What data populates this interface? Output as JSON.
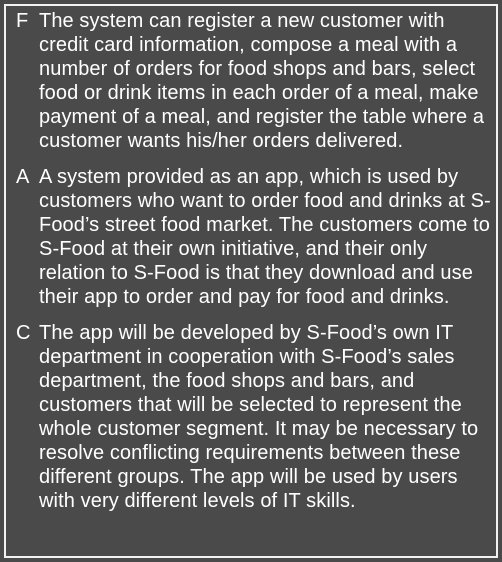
{
  "items": [
    {
      "letter": "F",
      "text": "The system can register a new customer with credit card information, compose a meal with a number of orders for food shops and bars, select food or drink items in each order of a meal, make payment of a meal, and register the table where a customer wants his/her orders delivered."
    },
    {
      "letter": "A",
      "text": "A system provided as an app, which is used by customers who want to order food and drinks at S-Food’s street food market. The customers come to S-Food at their own initiative, and their only relation to S-Food is that they download and use their app to order and pay for food and drinks."
    },
    {
      "letter": "C",
      "text": "The app will be developed by S-Food’s own IT department in cooperation with S-Food’s sales department, the food shops and bars, and customers that will be selected to represent the whole customer segment. It may be necessary to resolve conflicting requirements between these different groups. The app will be used by users with very different levels of IT skills."
    }
  ]
}
